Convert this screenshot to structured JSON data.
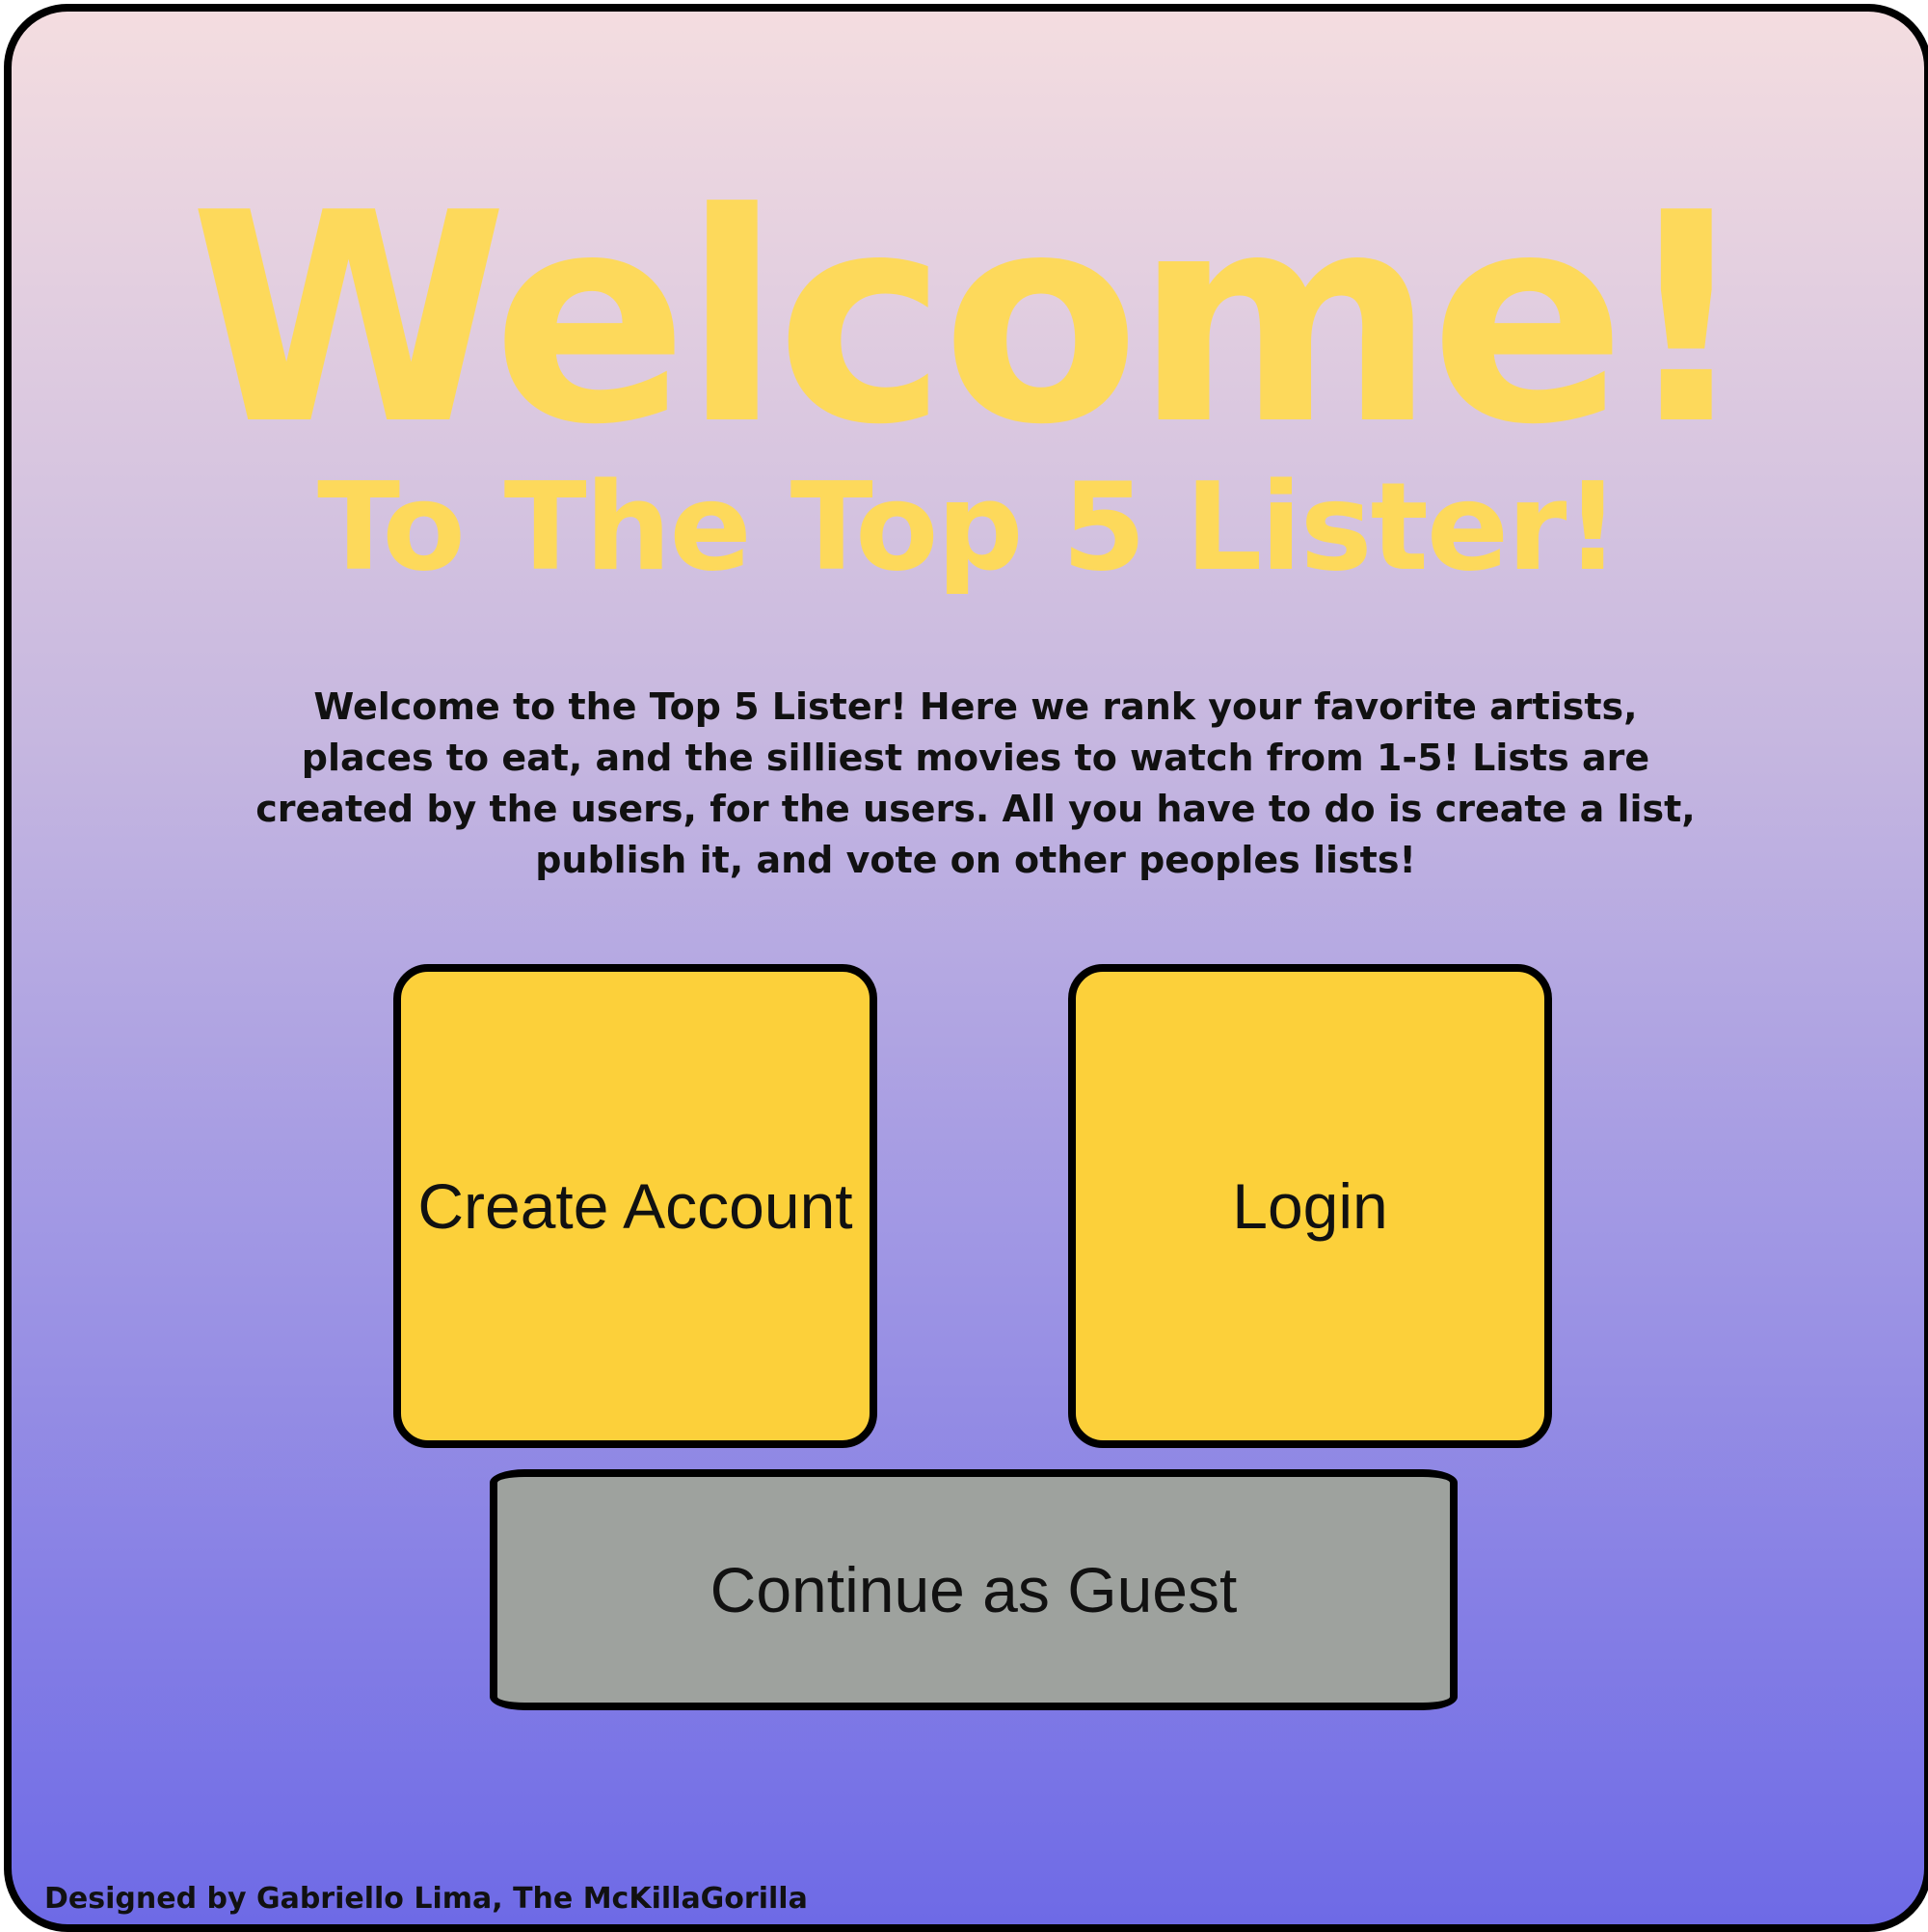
{
  "header": {
    "title": "Welcome!",
    "subtitle": "To The Top 5 Lister!"
  },
  "main": {
    "description": "Welcome to the Top 5 Lister! Here we rank your favorite artists, places to eat, and the silliest movies to watch from 1-5! Lists are created by the users, for the users. All you have to do is create a list, publish it, and vote on other peoples lists!"
  },
  "buttons": {
    "create_account": "Create Account",
    "login": "Login",
    "guest": "Continue as Guest"
  },
  "footer": {
    "credit": "Designed by Gabriello Lima, The McKillaGorilla"
  },
  "colors": {
    "title": "#fdd95b",
    "primary_button": "#fcd03a",
    "guest_button": "#9ea29e",
    "background_top": "#f4dde0",
    "background_bottom": "#6e6ae6"
  }
}
